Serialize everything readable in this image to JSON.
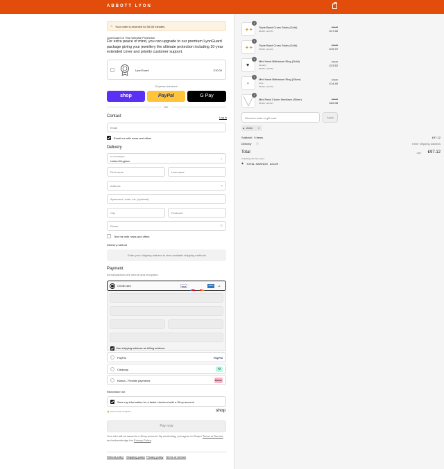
{
  "brand": "ABBOTT LYON",
  "notice": "Your order is reserved for 56:33 minutes.",
  "upsell": {
    "heading": "LyonGuard 10 Year Ultimate Protection",
    "body": "For extra peace of mind, you can upgrade to our premium LyonGuard package giving your jewellery the ultimate protection including 10-year extended cover and priority customer support.",
    "item_name": "LyonGuard",
    "item_price": "£10.00"
  },
  "express": {
    "label": "Express checkout",
    "shop": "shop",
    "paypal": "PayPal",
    "gpay": "G Pay",
    "or": "OR"
  },
  "contact": {
    "heading": "Contact",
    "login": "Log in",
    "email_placeholder": "Email",
    "news_label": "Email me with news and offers"
  },
  "delivery": {
    "heading": "Delivery",
    "country_label": "Country/Region",
    "country_value": "United Kingdom",
    "first": "First name",
    "last": "Last name",
    "address": "Address",
    "apartment": "Apartment, suite, etc. (optional)",
    "city": "City",
    "postcode": "Postcode",
    "phone": "Phone",
    "text_label": "Text me with news and offers",
    "method_heading": "Delivery method",
    "method_info": "Enter your shipping address to view available shipping methods."
  },
  "payment": {
    "heading": "Payment",
    "sub": "All transactions are secure and encrypted.",
    "card": "Credit card",
    "more": "+4",
    "billing": "Use shipping address as billing address",
    "paypal": "PayPal",
    "paypal_logo": "PayPal",
    "clearpay": "Clearpay",
    "klarna": "Klarna - Flexible payments",
    "klarna_logo": "Klarna."
  },
  "remember": {
    "heading": "Remember me",
    "save": "Save my information for a faster checkout with a Shop account",
    "secure": "Secure and encrypted",
    "shop": "shop"
  },
  "pay_now": "Pay now",
  "footer_text_a": "Your info will be saved to a Shop account. By continuing, you agree to Shop's ",
  "footer_tos": "Terms of Service",
  "footer_text_b": " and acknowledge the ",
  "footer_privacy": "Privacy Policy",
  "footer_end": ".",
  "policies": [
    "Refund policy",
    "Shipping policy",
    "Privacy policy",
    "Terms of service"
  ],
  "items": [
    {
      "name": "Triple Band Cross Studs (Gold)",
      "sub": "25OFF (-£4.35)",
      "was": "£21.75",
      "price": "£17.40",
      "qty": "1"
    },
    {
      "name": "Triple Band Cross Studs (Gold)",
      "sub": "25OFF (-£4.93)",
      "was": "£24.65",
      "price": "£19.72",
      "qty": "1"
    },
    {
      "name": "Mini Heart Birthstone Ring (Gold)",
      "sub": "January",
      "sub2": "25OFF (-£8.88)",
      "was": "£29.40",
      "price": "£23.52",
      "qty": "1"
    },
    {
      "name": "Mini Heart Birthstone Ring (Silver)",
      "sub": "June",
      "sub2": "25OFF (-£3.60)",
      "was": "£18.00",
      "price": "£14.40",
      "qty": "1"
    },
    {
      "name": "Mini Pearl Clover Necklace (Silver)",
      "sub": "25OFF (-£5.52)",
      "was": "£27.60",
      "price": "£22.08",
      "qty": "1"
    }
  ],
  "discount": {
    "placeholder": "Discount code or gift card",
    "apply": "Apply",
    "tag": "25OFF"
  },
  "summary": {
    "subtotal_label": "Subtotal · 5 items",
    "subtotal": "£97.12",
    "delivery_label": "Delivery",
    "delivery_value": "Enter shipping address",
    "total_label": "Total",
    "currency": "GBP",
    "total": "£97.12",
    "tax": "Including £16.19 in taxes",
    "savings_label": "TOTAL SAVINGS",
    "savings": "£24.29"
  }
}
